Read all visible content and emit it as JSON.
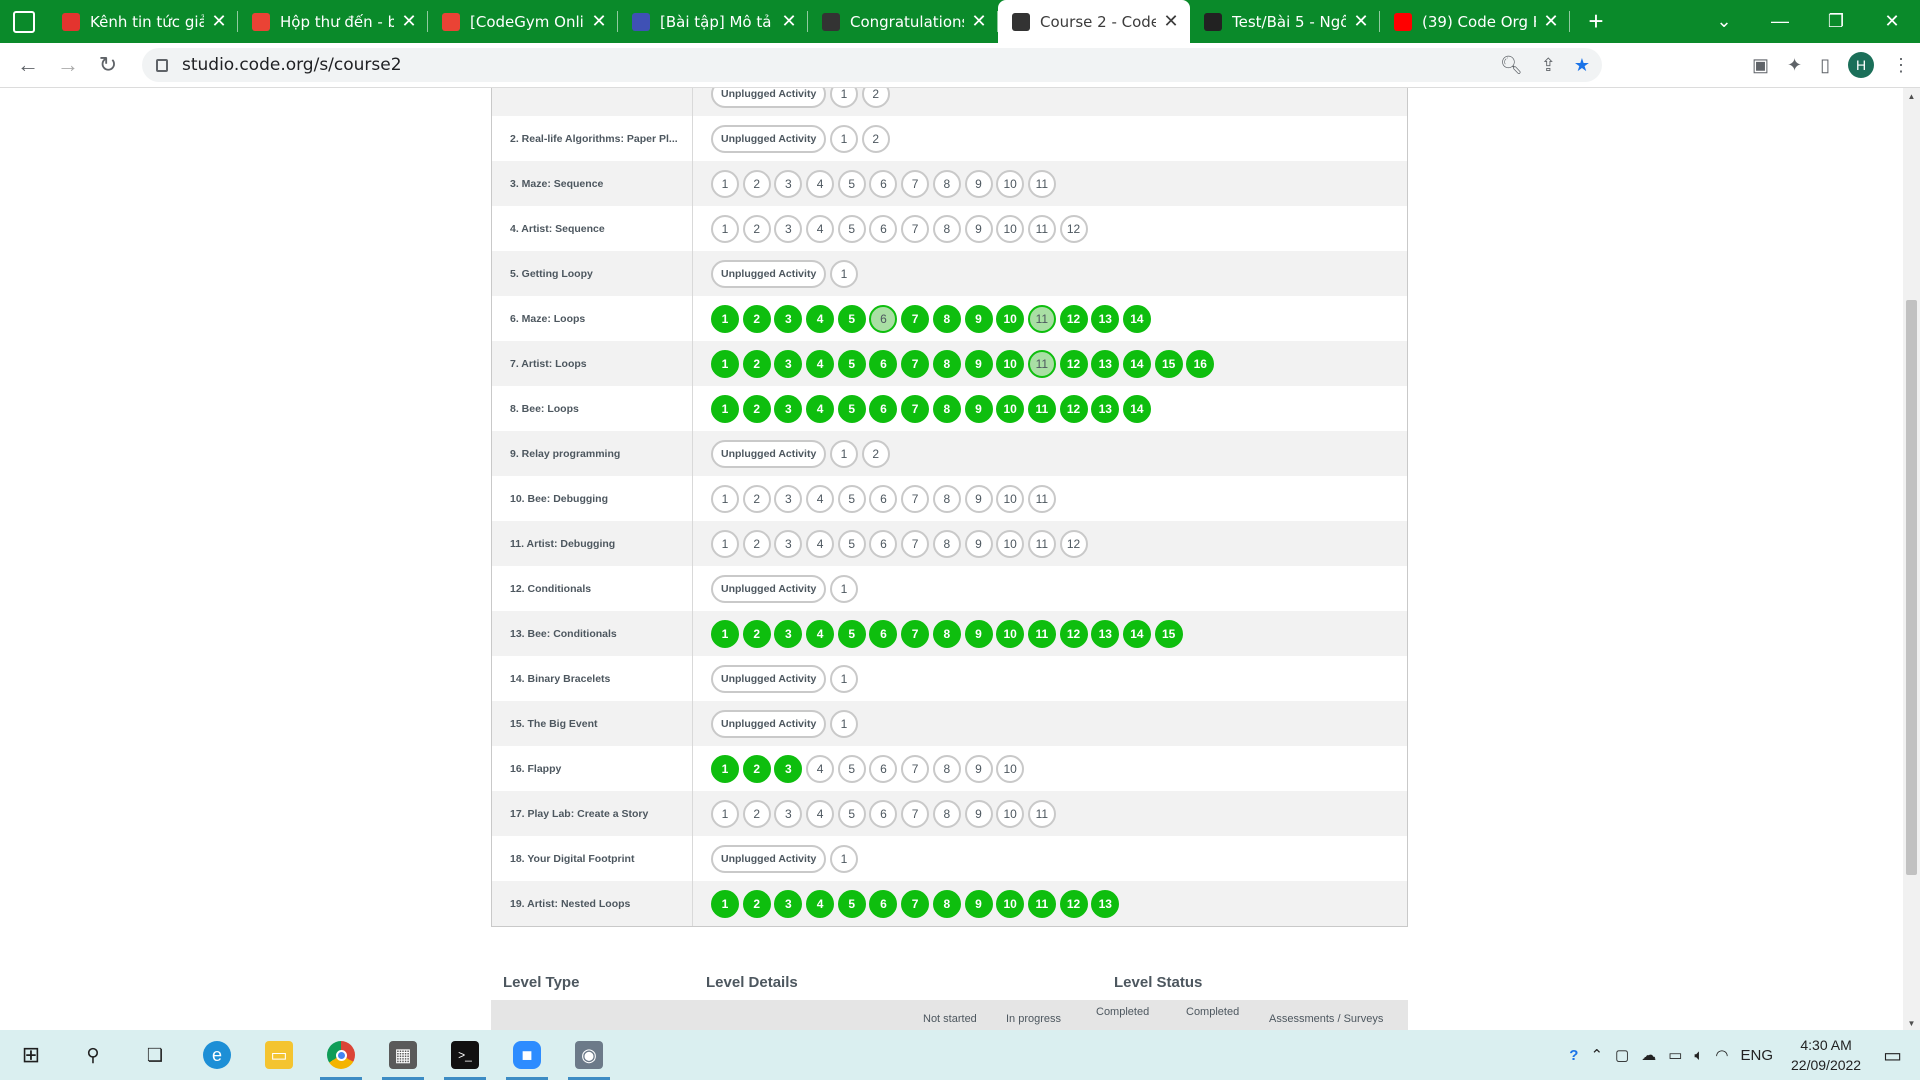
{
  "browser": {
    "tabs": [
      {
        "title": "Kênh tin tức giải",
        "favicon": "news-icon",
        "color": "#e3342f"
      },
      {
        "title": "Hộp thư đến - bi",
        "favicon": "gmail-icon",
        "color": "#ea4335"
      },
      {
        "title": "[CodeGym Onlin",
        "favicon": "gmail-icon",
        "color": "#ea4335"
      },
      {
        "title": "[Bài tập] Mô tả t",
        "favicon": "codegym-icon",
        "color": "#3f51b5"
      },
      {
        "title": "Congratulations",
        "favicon": "codeorg-icon",
        "color": "#333333"
      },
      {
        "title": "Course 2 - Code",
        "favicon": "codeorg-icon",
        "color": "#333333",
        "active": true
      },
      {
        "title": "Test/Bài 5 - Ngô",
        "favicon": "github-icon",
        "color": "#222222"
      },
      {
        "title": "(39) Code Org K",
        "favicon": "youtube-icon",
        "color": "#ff0000"
      }
    ],
    "url": "studio.code.org/s/course2",
    "profile_initial": "H",
    "accent_color": "#0a8a2a"
  },
  "progress": {
    "lessons": [
      {
        "name": "",
        "unplugged": true,
        "levels": [
          {
            "n": "1",
            "s": "none"
          },
          {
            "n": "2",
            "s": "none"
          }
        ]
      },
      {
        "name": "2. Real-life Algorithms: Paper Pl...",
        "unplugged": true,
        "levels": [
          {
            "n": "1",
            "s": "none"
          },
          {
            "n": "2",
            "s": "none"
          }
        ]
      },
      {
        "name": "3. Maze: Sequence",
        "unplugged": false,
        "levels": [
          {
            "n": "1",
            "s": "none"
          },
          {
            "n": "2",
            "s": "none"
          },
          {
            "n": "3",
            "s": "none"
          },
          {
            "n": "4",
            "s": "none"
          },
          {
            "n": "5",
            "s": "none"
          },
          {
            "n": "6",
            "s": "none"
          },
          {
            "n": "7",
            "s": "none"
          },
          {
            "n": "8",
            "s": "none"
          },
          {
            "n": "9",
            "s": "none"
          },
          {
            "n": "10",
            "s": "none"
          },
          {
            "n": "11",
            "s": "none"
          }
        ]
      },
      {
        "name": "4. Artist: Sequence",
        "unplugged": false,
        "levels": [
          {
            "n": "1",
            "s": "none"
          },
          {
            "n": "2",
            "s": "none"
          },
          {
            "n": "3",
            "s": "none"
          },
          {
            "n": "4",
            "s": "none"
          },
          {
            "n": "5",
            "s": "none"
          },
          {
            "n": "6",
            "s": "none"
          },
          {
            "n": "7",
            "s": "none"
          },
          {
            "n": "8",
            "s": "none"
          },
          {
            "n": "9",
            "s": "none"
          },
          {
            "n": "10",
            "s": "none"
          },
          {
            "n": "11",
            "s": "none"
          },
          {
            "n": "12",
            "s": "none"
          }
        ]
      },
      {
        "name": "5. Getting Loopy",
        "unplugged": true,
        "levels": [
          {
            "n": "1",
            "s": "none"
          }
        ]
      },
      {
        "name": "6. Maze: Loops",
        "unplugged": false,
        "levels": [
          {
            "n": "1",
            "s": "done"
          },
          {
            "n": "2",
            "s": "done"
          },
          {
            "n": "3",
            "s": "done"
          },
          {
            "n": "4",
            "s": "done"
          },
          {
            "n": "5",
            "s": "done"
          },
          {
            "n": "6",
            "s": "tried"
          },
          {
            "n": "7",
            "s": "done"
          },
          {
            "n": "8",
            "s": "done"
          },
          {
            "n": "9",
            "s": "done"
          },
          {
            "n": "10",
            "s": "done"
          },
          {
            "n": "11",
            "s": "tried"
          },
          {
            "n": "12",
            "s": "done"
          },
          {
            "n": "13",
            "s": "done"
          },
          {
            "n": "14",
            "s": "done"
          }
        ]
      },
      {
        "name": "7. Artist: Loops",
        "unplugged": false,
        "levels": [
          {
            "n": "1",
            "s": "done"
          },
          {
            "n": "2",
            "s": "done"
          },
          {
            "n": "3",
            "s": "done"
          },
          {
            "n": "4",
            "s": "done"
          },
          {
            "n": "5",
            "s": "done"
          },
          {
            "n": "6",
            "s": "done"
          },
          {
            "n": "7",
            "s": "done"
          },
          {
            "n": "8",
            "s": "done"
          },
          {
            "n": "9",
            "s": "done"
          },
          {
            "n": "10",
            "s": "done"
          },
          {
            "n": "11",
            "s": "tried"
          },
          {
            "n": "12",
            "s": "done"
          },
          {
            "n": "13",
            "s": "done"
          },
          {
            "n": "14",
            "s": "done"
          },
          {
            "n": "15",
            "s": "done"
          },
          {
            "n": "16",
            "s": "done"
          }
        ]
      },
      {
        "name": "8. Bee: Loops",
        "unplugged": false,
        "levels": [
          {
            "n": "1",
            "s": "done"
          },
          {
            "n": "2",
            "s": "done"
          },
          {
            "n": "3",
            "s": "done"
          },
          {
            "n": "4",
            "s": "done"
          },
          {
            "n": "5",
            "s": "done"
          },
          {
            "n": "6",
            "s": "done"
          },
          {
            "n": "7",
            "s": "done"
          },
          {
            "n": "8",
            "s": "done"
          },
          {
            "n": "9",
            "s": "done"
          },
          {
            "n": "10",
            "s": "done"
          },
          {
            "n": "11",
            "s": "done"
          },
          {
            "n": "12",
            "s": "done"
          },
          {
            "n": "13",
            "s": "done"
          },
          {
            "n": "14",
            "s": "done"
          }
        ]
      },
      {
        "name": "9. Relay programming",
        "unplugged": true,
        "levels": [
          {
            "n": "1",
            "s": "none"
          },
          {
            "n": "2",
            "s": "none"
          }
        ]
      },
      {
        "name": "10. Bee: Debugging",
        "unplugged": false,
        "levels": [
          {
            "n": "1",
            "s": "none"
          },
          {
            "n": "2",
            "s": "none"
          },
          {
            "n": "3",
            "s": "none"
          },
          {
            "n": "4",
            "s": "none"
          },
          {
            "n": "5",
            "s": "none"
          },
          {
            "n": "6",
            "s": "none"
          },
          {
            "n": "7",
            "s": "none"
          },
          {
            "n": "8",
            "s": "none"
          },
          {
            "n": "9",
            "s": "none"
          },
          {
            "n": "10",
            "s": "none"
          },
          {
            "n": "11",
            "s": "none"
          }
        ]
      },
      {
        "name": "11. Artist: Debugging",
        "unplugged": false,
        "levels": [
          {
            "n": "1",
            "s": "none"
          },
          {
            "n": "2",
            "s": "none"
          },
          {
            "n": "3",
            "s": "none"
          },
          {
            "n": "4",
            "s": "none"
          },
          {
            "n": "5",
            "s": "none"
          },
          {
            "n": "6",
            "s": "none"
          },
          {
            "n": "7",
            "s": "none"
          },
          {
            "n": "8",
            "s": "none"
          },
          {
            "n": "9",
            "s": "none"
          },
          {
            "n": "10",
            "s": "none"
          },
          {
            "n": "11",
            "s": "none"
          },
          {
            "n": "12",
            "s": "none"
          }
        ]
      },
      {
        "name": "12. Conditionals",
        "unplugged": true,
        "levels": [
          {
            "n": "1",
            "s": "none"
          }
        ]
      },
      {
        "name": "13. Bee: Conditionals",
        "unplugged": false,
        "levels": [
          {
            "n": "1",
            "s": "done"
          },
          {
            "n": "2",
            "s": "done"
          },
          {
            "n": "3",
            "s": "done"
          },
          {
            "n": "4",
            "s": "done"
          },
          {
            "n": "5",
            "s": "done"
          },
          {
            "n": "6",
            "s": "done"
          },
          {
            "n": "7",
            "s": "done"
          },
          {
            "n": "8",
            "s": "done"
          },
          {
            "n": "9",
            "s": "done"
          },
          {
            "n": "10",
            "s": "done"
          },
          {
            "n": "11",
            "s": "done"
          },
          {
            "n": "12",
            "s": "done"
          },
          {
            "n": "13",
            "s": "done"
          },
          {
            "n": "14",
            "s": "done"
          },
          {
            "n": "15",
            "s": "done"
          }
        ]
      },
      {
        "name": "14. Binary Bracelets",
        "unplugged": true,
        "levels": [
          {
            "n": "1",
            "s": "none"
          }
        ]
      },
      {
        "name": "15. The Big Event",
        "unplugged": true,
        "levels": [
          {
            "n": "1",
            "s": "none"
          }
        ]
      },
      {
        "name": "16. Flappy",
        "unplugged": false,
        "levels": [
          {
            "n": "1",
            "s": "done"
          },
          {
            "n": "2",
            "s": "done"
          },
          {
            "n": "3",
            "s": "done"
          },
          {
            "n": "4",
            "s": "none"
          },
          {
            "n": "5",
            "s": "none"
          },
          {
            "n": "6",
            "s": "none"
          },
          {
            "n": "7",
            "s": "none"
          },
          {
            "n": "8",
            "s": "none"
          },
          {
            "n": "9",
            "s": "none"
          },
          {
            "n": "10",
            "s": "none"
          }
        ]
      },
      {
        "name": "17. Play Lab: Create a Story",
        "unplugged": false,
        "levels": [
          {
            "n": "1",
            "s": "none"
          },
          {
            "n": "2",
            "s": "none"
          },
          {
            "n": "3",
            "s": "none"
          },
          {
            "n": "4",
            "s": "none"
          },
          {
            "n": "5",
            "s": "none"
          },
          {
            "n": "6",
            "s": "none"
          },
          {
            "n": "7",
            "s": "none"
          },
          {
            "n": "8",
            "s": "none"
          },
          {
            "n": "9",
            "s": "none"
          },
          {
            "n": "10",
            "s": "none"
          },
          {
            "n": "11",
            "s": "none"
          }
        ]
      },
      {
        "name": "18. Your Digital Footprint",
        "unplugged": true,
        "levels": [
          {
            "n": "1",
            "s": "none"
          }
        ]
      },
      {
        "name": "19. Artist: Nested Loops",
        "unplugged": false,
        "levels": [
          {
            "n": "1",
            "s": "done"
          },
          {
            "n": "2",
            "s": "done"
          },
          {
            "n": "3",
            "s": "done"
          },
          {
            "n": "4",
            "s": "done"
          },
          {
            "n": "5",
            "s": "done"
          },
          {
            "n": "6",
            "s": "done"
          },
          {
            "n": "7",
            "s": "done"
          },
          {
            "n": "8",
            "s": "done"
          },
          {
            "n": "9",
            "s": "done"
          },
          {
            "n": "10",
            "s": "done"
          },
          {
            "n": "11",
            "s": "done"
          },
          {
            "n": "12",
            "s": "done"
          },
          {
            "n": "13",
            "s": "done"
          }
        ]
      }
    ],
    "unplugged_label": "Unplugged Activity",
    "colors": {
      "done": "#0ebe0e",
      "tried": "#a9dfa4",
      "border": "#c9c9c9"
    }
  },
  "key": {
    "headers": {
      "level_type": "Level Type",
      "level_details": "Level Details",
      "level_status": "Level Status"
    },
    "columns": [
      "Not started",
      "In progress",
      "Completed",
      "Completed",
      "Assessments / Surveys"
    ]
  },
  "taskbar": {
    "apps": [
      "windows-start-icon",
      "search-icon",
      "task-view-icon",
      "edge-icon",
      "file-explorer-icon",
      "chrome-icon",
      "calculator-icon",
      "terminal-icon",
      "zoom-icon",
      "camera-icon"
    ],
    "language": "ENG",
    "time": "4:30 AM",
    "date": "22/09/2022"
  }
}
